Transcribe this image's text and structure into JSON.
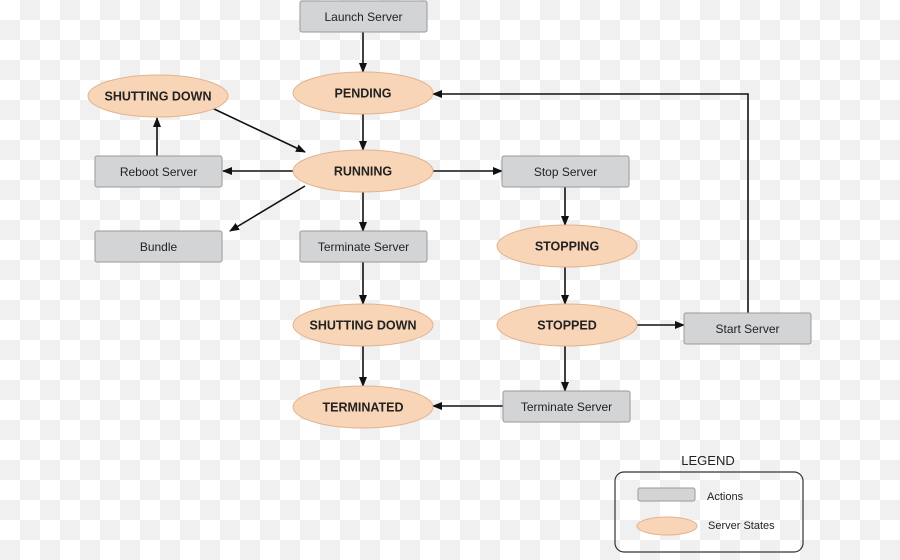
{
  "nodes": {
    "launch": {
      "label": "Launch Server",
      "kind": "action"
    },
    "pending": {
      "label": "PENDING",
      "kind": "state"
    },
    "shutting_down_reboot": {
      "label": "SHUTTING DOWN",
      "kind": "state"
    },
    "running": {
      "label": "RUNNING",
      "kind": "state"
    },
    "reboot": {
      "label": "Reboot Server",
      "kind": "action"
    },
    "stop": {
      "label": "Stop Server",
      "kind": "action"
    },
    "bundle": {
      "label": "Bundle",
      "kind": "action"
    },
    "terminate": {
      "label": "Terminate Server",
      "kind": "action"
    },
    "stopping": {
      "label": "STOPPING",
      "kind": "state"
    },
    "shutting_down": {
      "label": "SHUTTING DOWN",
      "kind": "state"
    },
    "stopped": {
      "label": "STOPPED",
      "kind": "state"
    },
    "start": {
      "label": "Start Server",
      "kind": "action"
    },
    "terminated": {
      "label": "TERMINATED",
      "kind": "state"
    },
    "terminate_stopped": {
      "label": "Terminate Server",
      "kind": "action"
    }
  },
  "edges": [
    [
      "launch",
      "pending"
    ],
    [
      "pending",
      "running"
    ],
    [
      "running",
      "reboot"
    ],
    [
      "reboot",
      "shutting_down_reboot"
    ],
    [
      "shutting_down_reboot",
      "running"
    ],
    [
      "running",
      "bundle"
    ],
    [
      "running",
      "terminate"
    ],
    [
      "running",
      "stop"
    ],
    [
      "stop",
      "stopping"
    ],
    [
      "stopping",
      "stopped"
    ],
    [
      "stopped",
      "start"
    ],
    [
      "start",
      "pending"
    ],
    [
      "terminate",
      "shutting_down"
    ],
    [
      "shutting_down",
      "terminated"
    ],
    [
      "stopped",
      "terminate_stopped"
    ],
    [
      "terminate_stopped",
      "terminated"
    ]
  ],
  "legend": {
    "title": "LEGEND",
    "actions_label": "Actions",
    "states_label": "Server States"
  },
  "colors": {
    "action_fill": "#d3d4d6",
    "action_stroke": "#9a9a9a",
    "state_fill": "#f9d5b8",
    "state_stroke": "#e2b28e",
    "arrow": "#111111"
  }
}
